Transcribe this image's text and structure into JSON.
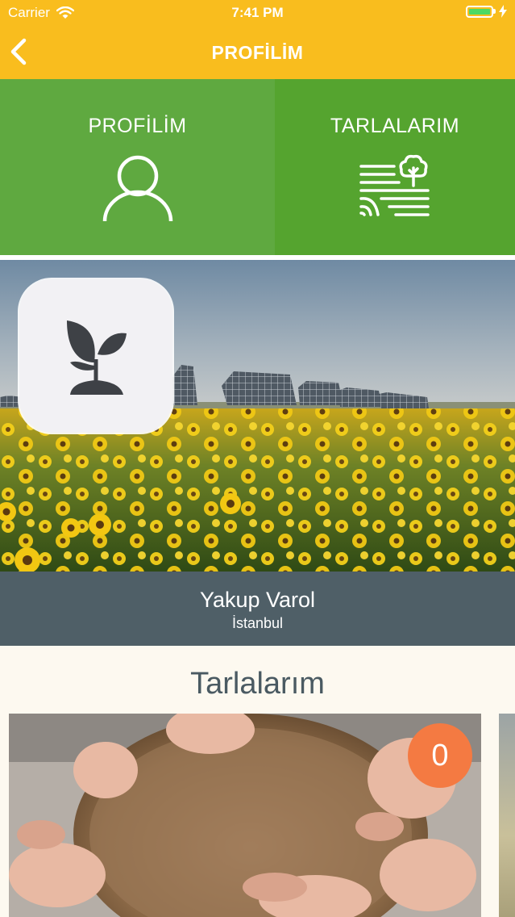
{
  "status_bar": {
    "carrier": "Carrier",
    "time": "7:41 PM",
    "battery_level": 1.0
  },
  "nav": {
    "title": "PROFİLİM",
    "back_icon": "chevron-left-icon"
  },
  "tabs": [
    {
      "label": "PROFİLİM",
      "icon": "user-icon",
      "active": true
    },
    {
      "label": "TARLALARIM",
      "icon": "field-tree-icon",
      "active": false
    }
  ],
  "profile": {
    "name": "Yakup Varol",
    "city": "İstanbul",
    "avatar_icon": "sprout-icon",
    "cover_image": "sunflower-field-solar-panels"
  },
  "fields": {
    "title": "Tarlalarım",
    "cards": [
      {
        "image": "hands-holding-wooden-bowl",
        "count": "0"
      }
    ]
  },
  "colors": {
    "accent": "#f9bd1e",
    "tab_active": "#5fa940",
    "tab_inactive": "#55a42f",
    "name_bar": "#4f5f67",
    "badge": "#f47a42",
    "background": "#fdf9f0"
  }
}
